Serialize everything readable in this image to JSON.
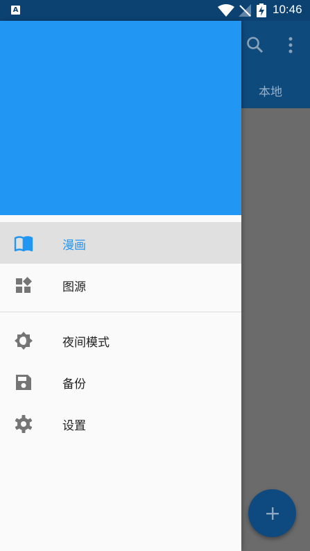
{
  "status_bar": {
    "notification_icon": "A",
    "time": "10:46",
    "icons": [
      "wifi-icon",
      "no-signal-icon",
      "battery-charging-icon"
    ]
  },
  "toolbar": {
    "icons": [
      "search-icon",
      "more-vert-icon"
    ],
    "tab_label": "本地"
  },
  "drawer": {
    "menu": [
      {
        "label": "漫画",
        "icon": "book-icon",
        "selected": true
      },
      {
        "label": "图源",
        "icon": "widgets-icon",
        "selected": false
      },
      {
        "label": "夜间模式",
        "icon": "night-mode-icon",
        "selected": false
      },
      {
        "label": "备份",
        "icon": "save-icon",
        "selected": false
      },
      {
        "label": "设置",
        "icon": "settings-icon",
        "selected": false
      }
    ]
  },
  "fab": {
    "icon": "add-icon"
  },
  "colors": {
    "primary": "#2196f3",
    "status_bar": "#0b4272",
    "selected_item_bg": "#e0e0e0",
    "icon_gray": "#757575"
  }
}
